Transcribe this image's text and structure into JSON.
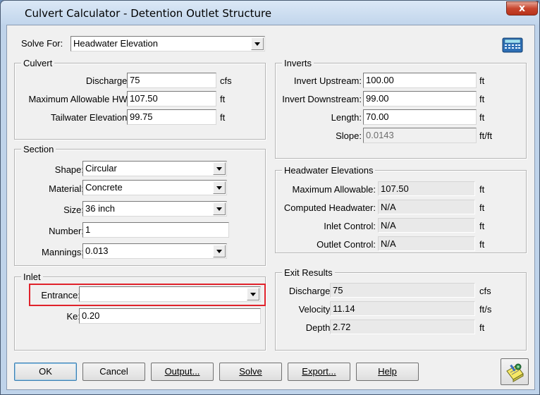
{
  "window": {
    "title": "Culvert Calculator - Detention Outlet Structure",
    "close_glyph": "x"
  },
  "solve_for": {
    "label": "Solve For:",
    "value": "Headwater Elevation"
  },
  "culvert": {
    "title": "Culvert",
    "discharge": {
      "label": "Discharge:",
      "value": "75",
      "unit": "cfs"
    },
    "max_hw": {
      "label": "Maximum Allowable HW:",
      "value": "107.50",
      "unit": "ft"
    },
    "tailwater": {
      "label": "Tailwater Elevation:",
      "value": "99.75",
      "unit": "ft"
    }
  },
  "inverts": {
    "title": "Inverts",
    "upstream": {
      "label": "Invert Upstream:",
      "value": "100.00",
      "unit": "ft"
    },
    "downstream": {
      "label": "Invert Downstream:",
      "value": "99.00",
      "unit": "ft"
    },
    "length": {
      "label": "Length:",
      "value": "70.00",
      "unit": "ft"
    },
    "slope": {
      "label": "Slope:",
      "value": "0.0143",
      "unit": "ft/ft"
    }
  },
  "section": {
    "title": "Section",
    "shape": {
      "label": "Shape:",
      "value": "Circular"
    },
    "material": {
      "label": "Material:",
      "value": "Concrete"
    },
    "size": {
      "label": "Size:",
      "value": "36 inch"
    },
    "number": {
      "label": "Number:",
      "value": "1"
    },
    "mannings": {
      "label": "Mannings:",
      "value": "0.013"
    }
  },
  "headwater": {
    "title": "Headwater Elevations",
    "max_allowable": {
      "label": "Maximum Allowable:",
      "value": "107.50",
      "unit": "ft"
    },
    "computed": {
      "label": "Computed Headwater:",
      "value": "N/A",
      "unit": "ft"
    },
    "inlet_control": {
      "label": "Inlet Control:",
      "value": "N/A",
      "unit": "ft"
    },
    "outlet_control": {
      "label": "Outlet Control:",
      "value": "N/A",
      "unit": "ft"
    }
  },
  "inlet": {
    "title": "Inlet",
    "entrance": {
      "label": "Entrance:",
      "value": ""
    },
    "ke": {
      "label": "Ke:",
      "value": "0.20"
    }
  },
  "exit": {
    "title": "Exit Results",
    "discharge": {
      "label": "Discharge:",
      "value": "75",
      "unit": "cfs"
    },
    "velocity": {
      "label": "Velocity:",
      "value": "11.14",
      "unit": "ft/s"
    },
    "depth": {
      "label": "Depth:",
      "value": "2.72",
      "unit": "ft"
    }
  },
  "buttons": {
    "ok": "OK",
    "cancel": "Cancel",
    "output": "Output...",
    "solve": "Solve",
    "export": "Export...",
    "help": "Help"
  },
  "icons": {
    "calculator": "calculator-icon",
    "notes": "notepad-pencil-icon"
  },
  "colors": {
    "highlight": "#e0222b",
    "close": "#c8462e"
  }
}
